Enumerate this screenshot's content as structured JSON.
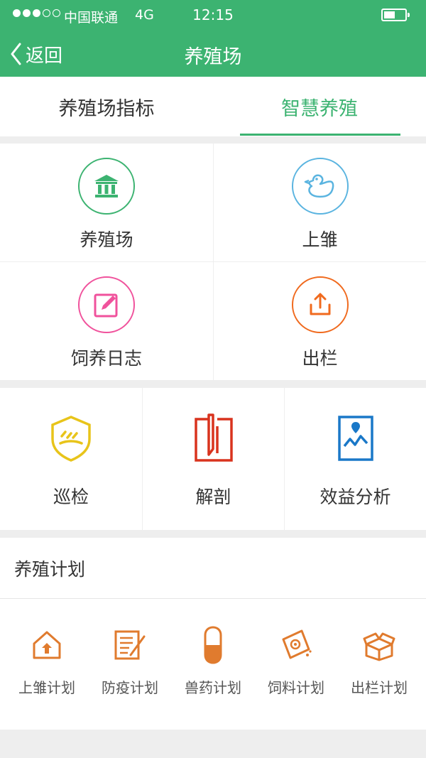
{
  "status_bar": {
    "carrier": "中国联通",
    "network": "4G",
    "time": "12:15",
    "signal_bars_filled": 3,
    "signal_bars_total": 5
  },
  "header": {
    "back_label": "返回",
    "title": "养殖场",
    "color": "#3cb371"
  },
  "tabs": [
    {
      "label": "养殖场指标",
      "active": false
    },
    {
      "label": "智慧养殖",
      "active": true
    }
  ],
  "grid_main": [
    {
      "label": "养殖场",
      "icon": "bank-icon",
      "color": "#3cb371"
    },
    {
      "label": "上雏",
      "icon": "duck-icon",
      "color": "#5ab4e0"
    },
    {
      "label": "饲养日志",
      "icon": "edit-icon",
      "color": "#f0529c"
    },
    {
      "label": "出栏",
      "icon": "upload-icon",
      "color": "#f06a1e"
    }
  ],
  "grid_tools": [
    {
      "label": "巡检",
      "icon": "shield-icon",
      "color": "#e8c41a"
    },
    {
      "label": "解剖",
      "icon": "dissection-icon",
      "color": "#d9331e"
    },
    {
      "label": "效益分析",
      "icon": "chart-icon",
      "color": "#1a78c8"
    }
  ],
  "plan": {
    "title": "养殖计划",
    "items": [
      {
        "label": "上雏计划",
        "icon": "house-upload-icon"
      },
      {
        "label": "防疫计划",
        "icon": "notepad-icon"
      },
      {
        "label": "兽药计划",
        "icon": "capsule-icon"
      },
      {
        "label": "饲料计划",
        "icon": "feed-bag-icon"
      },
      {
        "label": "出栏计划",
        "icon": "box-icon"
      }
    ],
    "color": "#e07b2e"
  }
}
